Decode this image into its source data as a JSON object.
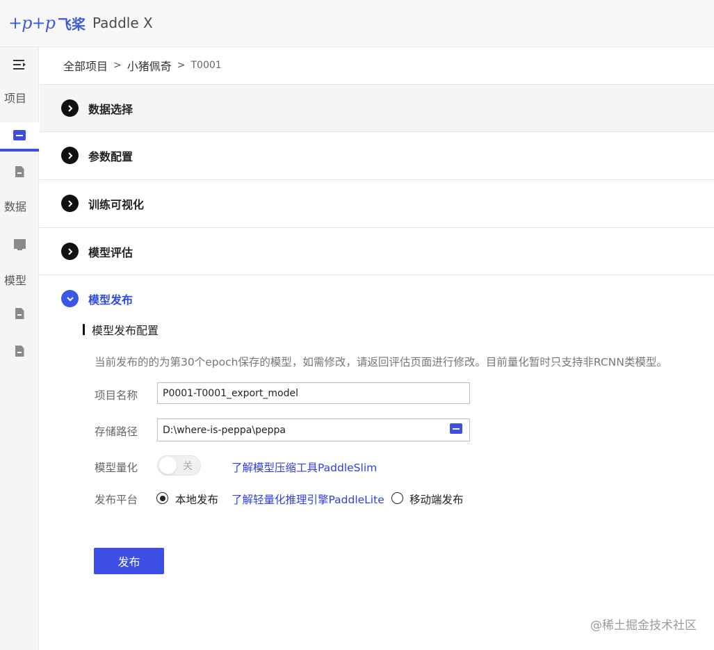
{
  "app": {
    "logo_mark": "+p+p",
    "logo_cn": "飞桨",
    "logo_en": "Paddle X"
  },
  "sidebar": {
    "menu_icon": "menu-collapse-icon",
    "items": [
      {
        "label": "项目"
      },
      {
        "label": "数据"
      },
      {
        "label": "模型"
      }
    ]
  },
  "breadcrumb": {
    "items": [
      "全部项目",
      "小猪佩奇"
    ],
    "separator": ">",
    "current": "T0001"
  },
  "sections": [
    {
      "title": "数据选择",
      "expanded": false
    },
    {
      "title": "参数配置",
      "expanded": false
    },
    {
      "title": "训练可视化",
      "expanded": false
    },
    {
      "title": "模型评估",
      "expanded": false
    },
    {
      "title": "模型发布",
      "expanded": true
    }
  ],
  "publish": {
    "heading": "模型发布配置",
    "notice": "当前发布的的为第30个epoch保存的模型，如需修改，请返回评估页面进行修改。目前量化暂时只支持非RCNN类模型。",
    "project_name_label": "项目名称",
    "project_name_value": "P0001-T0001_export_model",
    "storage_path_label": "存储路径",
    "storage_path_value": "D:\\where-is-peppa\\peppa",
    "quantize_label": "模型量化",
    "quantize_toggle_text": "关",
    "quantize_link": "了解模型压缩工具PaddleSlim",
    "platform_label": "发布平台",
    "platform_local": "本地发布",
    "platform_link": "了解轻量化推理引擎PaddleLite",
    "platform_mobile": "移动端发布",
    "platform_selected": "本地发布",
    "submit_label": "发布"
  },
  "watermark": "@稀土掘金技术社区",
  "colors": {
    "accent": "#3d4fe4",
    "link": "#3040e6"
  }
}
